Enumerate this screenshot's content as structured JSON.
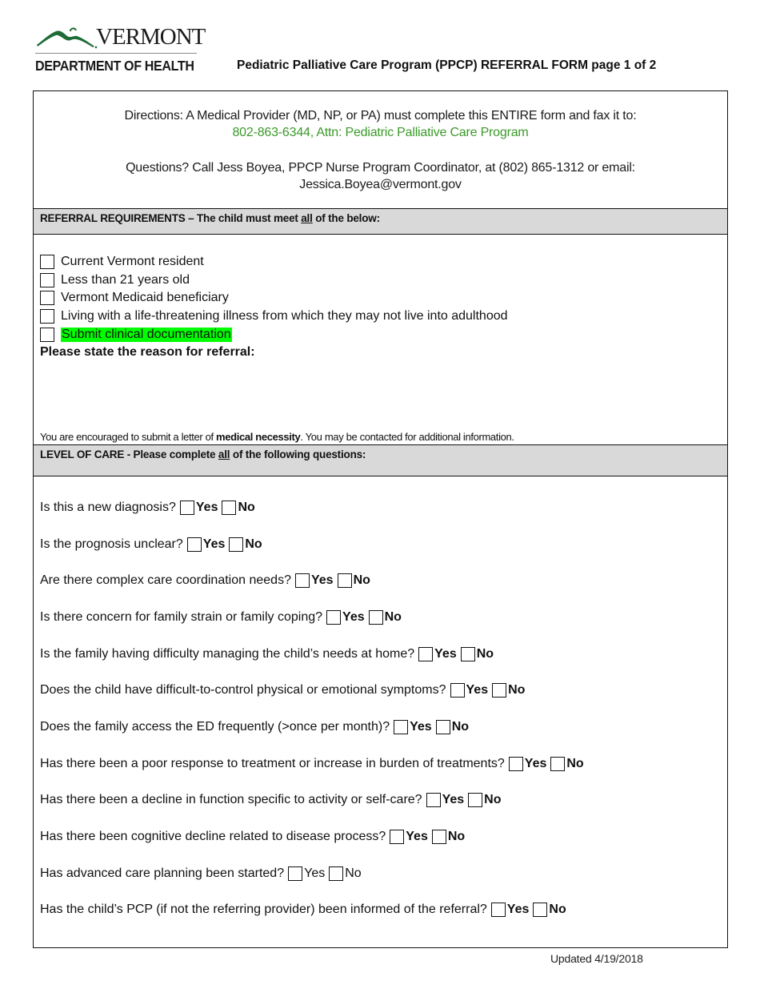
{
  "header": {
    "logo_wordmark": "VERMONT",
    "logo_department": "DEPARTMENT OF HEALTH",
    "form_title": "Pediatric Palliative Care Program (PPCP) REFERRAL FORM  page 1 of 2",
    "logo_color": "#1e6b35"
  },
  "directions": {
    "line1": "Directions: A Medical Provider (MD, NP, or PA) must complete this ENTIRE form and fax it to:",
    "fax_line": "802-863-6344, Attn: Pediatric Palliative Care Program",
    "questions_line": "Questions? Call Jess Boyea, PPCP Nurse Program Coordinator, at (802) 865-1312 or email:",
    "email": "Jessica.Boyea@vermont.gov",
    "fax_color": "#3a9a2a"
  },
  "referral_requirements": {
    "header_prefix": "REFERRAL REQUIREMENTS – The child must meet ",
    "header_emphasis": "all",
    "header_suffix": " of the below:",
    "items": [
      {
        "label": "Current Vermont resident",
        "checked": false,
        "highlight": false
      },
      {
        "label": "Less than 21 years old",
        "checked": false,
        "highlight": false
      },
      {
        "label": "Vermont Medicaid beneficiary",
        "checked": false,
        "highlight": false
      },
      {
        "label": "Living with a life-threatening illness from which they may not live into adulthood",
        "checked": false,
        "highlight": false
      },
      {
        "label": "Submit clinical documentation",
        "checked": false,
        "highlight": true
      }
    ],
    "highlight_color": "#00ff00",
    "reason_label": "Please state the reason for referral:",
    "reason_value": "",
    "encourage_prefix": "You are encouraged to submit a letter of ",
    "encourage_bold": "medical necessity",
    "encourage_suffix": ". You may be contacted for additional information."
  },
  "level_of_care": {
    "header_prefix": "LEVEL OF CARE - Please complete ",
    "header_emphasis": "all",
    "header_suffix": " of the following questions:",
    "yes_label": "Yes",
    "no_label": "No",
    "questions": [
      {
        "text": "Is this a new diagnosis?",
        "yes": false,
        "no": false,
        "bold_options": true
      },
      {
        "text": "Is the prognosis unclear?",
        "yes": false,
        "no": false,
        "bold_options": true
      },
      {
        "text": "Are there complex care coordination needs?",
        "yes": false,
        "no": false,
        "bold_options": true
      },
      {
        "text": "Is there concern for family strain or family coping?",
        "yes": false,
        "no": false,
        "bold_options": true
      },
      {
        "text": "Is the family having difficulty managing the child’s needs at home?",
        "yes": false,
        "no": false,
        "bold_options": true
      },
      {
        "text": "Does the child have difficult-to-control physical or emotional symptoms?",
        "yes": false,
        "no": false,
        "bold_options": true
      },
      {
        "text": "Does the family access the ED frequently (>once per month)?",
        "yes": false,
        "no": false,
        "bold_options": true
      },
      {
        "text": "Has there been a poor response to treatment or increase in burden of treatments?",
        "yes": false,
        "no": false,
        "bold_options": true
      },
      {
        "text": "Has there been a decline in function specific to activity or self-care?",
        "yes": false,
        "no": false,
        "bold_options": true
      },
      {
        "text": "Has there been cognitive decline related to disease process?",
        "yes": false,
        "no": false,
        "bold_options": true
      },
      {
        "text": "Has advanced care planning been started?",
        "yes": false,
        "no": false,
        "bold_options": false
      },
      {
        "text": "Has the child’s PCP (if not the referring provider) been informed of the referral?",
        "yes": false,
        "no": false,
        "bold_options": true
      }
    ]
  },
  "footer": {
    "updated": "Updated 4/19/2018"
  }
}
